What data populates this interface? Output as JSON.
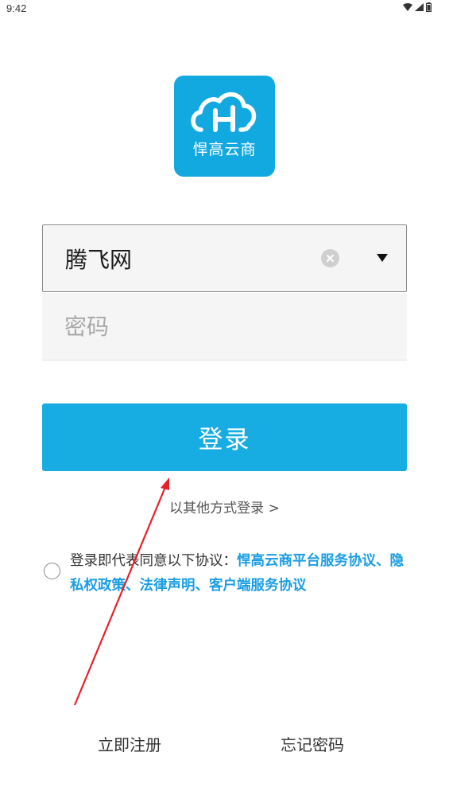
{
  "status_bar": {
    "time": "9:42",
    "icons": [
      "wifi-icon",
      "signal-icon",
      "battery-icon"
    ]
  },
  "logo": {
    "text": "悍高云商",
    "color": "#12a9e0"
  },
  "account": {
    "value": "腾飞网"
  },
  "password": {
    "placeholder": "密码"
  },
  "login_button": {
    "label": "登录",
    "color": "#17ade3"
  },
  "other_login": "以其他方式登录 >",
  "agreement": {
    "prefix": "登录即代表同意以下协议：",
    "links": "悍高云商平台服务协议、隐私权政策、法律声明、客户端服务协议",
    "link_color": "#1a9ee3"
  },
  "footer": {
    "register": "立即注册",
    "forgot": "忘记密码"
  },
  "annotation_color": "#e8202a"
}
